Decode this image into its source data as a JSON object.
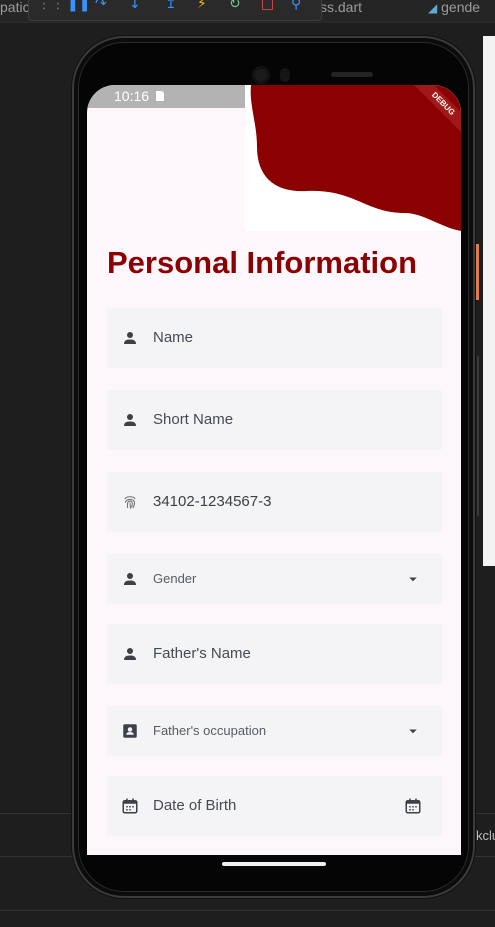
{
  "ide": {
    "tab_left": "patic",
    "tab_mid": "ss.dart",
    "tab_right": "gende",
    "bottom_text": "kclu"
  },
  "status_bar": {
    "time": "10:16"
  },
  "debug_banner": "DEBUG",
  "page_title": "Personal Information",
  "fields": {
    "name": {
      "label": "Name",
      "icon": "person-icon"
    },
    "short_name": {
      "label": "Short Name",
      "icon": "person-icon"
    },
    "cnic": {
      "value": "34102-1234567-3",
      "icon": "fingerprint-icon"
    },
    "gender": {
      "label": "Gender",
      "icon": "person-icon",
      "trailing": "dropdown-arrow-icon"
    },
    "father_name": {
      "label": "Father's Name",
      "icon": "person-icon"
    },
    "father_occupation": {
      "label": "Father's occupation",
      "icon": "badge-icon",
      "trailing": "dropdown-arrow-icon"
    },
    "dob": {
      "label": "Date of Birth",
      "icon": "calendar-icon",
      "trailing": "calendar-icon"
    }
  },
  "colors": {
    "accent": "#8b0000",
    "field_bg": "#f4f4f7",
    "screen_bg": "#fdf7fc"
  }
}
